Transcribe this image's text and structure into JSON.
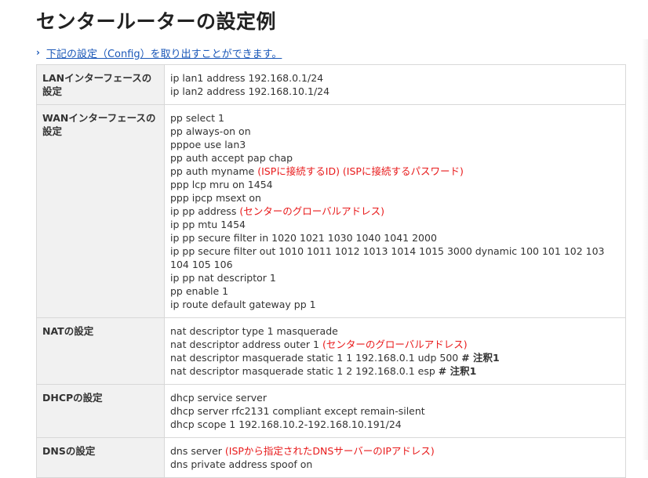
{
  "page": {
    "title": "センタールーターの設定例",
    "config_link": "下記の設定（Config）を取り出すことができます。"
  },
  "colors": {
    "link": "#1a57b8",
    "note_red": "#e8191a",
    "label_bg": "#f1f1f1"
  },
  "icons": {
    "link_chevron": "chevron-right-icon"
  },
  "rows": [
    {
      "label": "LANインターフェースの設定",
      "lines": [
        [
          {
            "t": "ip lan1 address 192.168.0.1/24"
          }
        ],
        [
          {
            "t": "ip lan2 address 192.168.10.1/24"
          }
        ]
      ]
    },
    {
      "label": "WANインターフェースの設定",
      "lines": [
        [
          {
            "t": "pp select 1"
          }
        ],
        [
          {
            "t": "pp always-on on"
          }
        ],
        [
          {
            "t": "pppoe use lan3"
          }
        ],
        [
          {
            "t": "pp auth accept pap chap"
          }
        ],
        [
          {
            "t": "pp auth myname "
          },
          {
            "t": "(ISPに接続するID) (ISPに接続するパスワード)",
            "s": "red"
          }
        ],
        [
          {
            "t": "ppp lcp mru on 1454"
          }
        ],
        [
          {
            "t": "ppp ipcp msext on"
          }
        ],
        [
          {
            "t": "ip pp address "
          },
          {
            "t": "(センターのグローバルアドレス)",
            "s": "red"
          }
        ],
        [
          {
            "t": "ip pp mtu 1454"
          }
        ],
        [
          {
            "t": "ip pp secure filter in 1020 1021 1030 1040 1041 2000"
          }
        ],
        [
          {
            "t": "ip pp secure filter out 1010 1011 1012 1013 1014 1015 3000 dynamic 100 101 102 103 104 105 106"
          }
        ],
        [
          {
            "t": "ip pp nat descriptor 1"
          }
        ],
        [
          {
            "t": "pp enable 1"
          }
        ],
        [
          {
            "t": "ip route default gateway pp 1"
          }
        ]
      ]
    },
    {
      "label": "NATの設定",
      "lines": [
        [
          {
            "t": "nat descriptor type 1 masquerade"
          }
        ],
        [
          {
            "t": "nat descriptor address outer 1 "
          },
          {
            "t": "(センターのグローバルアドレス)",
            "s": "red"
          }
        ],
        [
          {
            "t": "nat descriptor masquerade static 1 1 192.168.0.1 udp 500 "
          },
          {
            "t": "# 注釈1",
            "s": "bold"
          }
        ],
        [
          {
            "t": "nat descriptor masquerade static 1 2 192.168.0.1 esp "
          },
          {
            "t": "# 注釈1",
            "s": "bold"
          }
        ]
      ]
    },
    {
      "label": "DHCPの設定",
      "lines": [
        [
          {
            "t": "dhcp service server"
          }
        ],
        [
          {
            "t": "dhcp server rfc2131 compliant except remain-silent"
          }
        ],
        [
          {
            "t": "dhcp scope 1 192.168.10.2-192.168.10.191/24"
          }
        ]
      ]
    },
    {
      "label": "DNSの設定",
      "lines": [
        [
          {
            "t": "dns server "
          },
          {
            "t": "(ISPから指定されたDNSサーバーのIPアドレス)",
            "s": "red"
          }
        ],
        [
          {
            "t": "dns private address spoof on"
          }
        ]
      ]
    }
  ]
}
